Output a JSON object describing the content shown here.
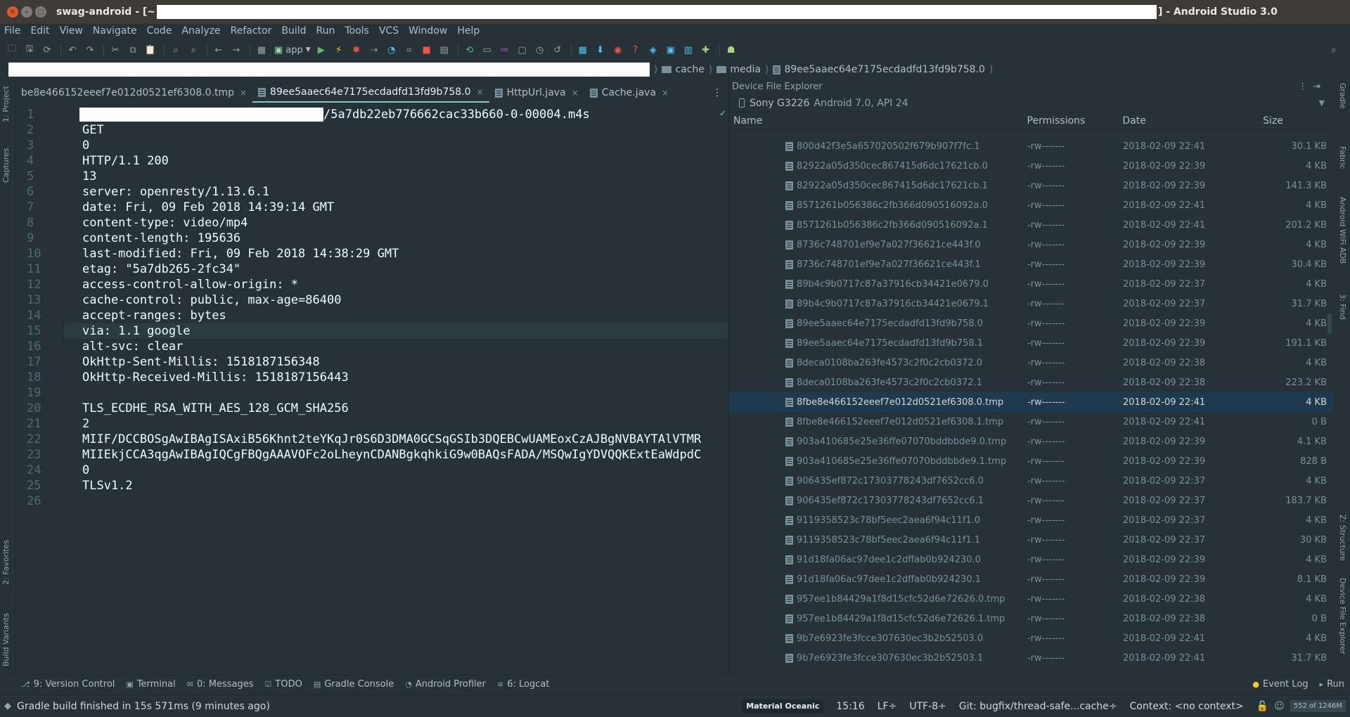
{
  "window": {
    "title_left": "swag-android - [~",
    "title_right": "] - Android Studio 3.0"
  },
  "menu": [
    "File",
    "Edit",
    "View",
    "Navigate",
    "Code",
    "Analyze",
    "Refactor",
    "Build",
    "Run",
    "Tools",
    "VCS",
    "Window",
    "Help"
  ],
  "toolbar": {
    "run_config": "app"
  },
  "breadcrumbs": [
    "cache",
    "media",
    "89ee5aaec64e7175ecdadfd13fd9b758.0"
  ],
  "side_left": {
    "project": "1: Project",
    "captures": "Captures",
    "favorites": "2: Favorites",
    "build_variants": "Build Variants"
  },
  "side_right": {
    "gradle": "Gradle",
    "fabric": "Fabric",
    "wifi_adb": "Android WiFi ADB",
    "find": "3: Find",
    "structure": "Z: Structure",
    "dfe": "Device File Explorer"
  },
  "tabs": [
    {
      "label": "be8e466152eeef7e012d0521ef6308.0.tmp",
      "active": false
    },
    {
      "label": "89ee5aaec64e7175ecdadfd13fd9b758.0",
      "active": true
    },
    {
      "label": "HttpUrl.java",
      "active": false
    },
    {
      "label": "Cache.java",
      "active": false
    }
  ],
  "editor": {
    "first_line_suffix": "/5a7db22eb776662cac33b660-0-00004.m4s",
    "lines": [
      "",
      "GET",
      "0",
      "HTTP/1.1 200",
      "13",
      "server: openresty/1.13.6.1",
      "date: Fri, 09 Feb 2018 14:39:14 GMT",
      "content-type: video/mp4",
      "content-length: 195636",
      "last-modified: Fri, 09 Feb 2018 14:38:29 GMT",
      "etag: \"5a7db265-2fc34\"",
      "access-control-allow-origin: *",
      "cache-control: public, max-age=86400",
      "accept-ranges: bytes",
      "via: 1.1 google",
      "alt-svc: clear",
      "OkHttp-Sent-Millis: 1518187156348",
      "OkHttp-Received-Millis: 1518187156443",
      "",
      "TLS_ECDHE_RSA_WITH_AES_128_GCM_SHA256",
      "2",
      "MIIF/DCCBOSgAwIBAgISAxiB56Khnt2teYKqJr0S6D3DMA0GCSqGSIb3DQEBCwUAMEoxCzAJBgNVBAYTAlVTMR",
      "MIIEkjCCA3qgAwIBAgIQCgFBQgAAAVOFc2oLheynCDANBgkqhkiG9w0BAQsFADA/MSQwIgYDVQQKExtEaWdpdC",
      "0",
      "TLSv1.2",
      ""
    ],
    "highlight_line": 15
  },
  "device_explorer": {
    "title": "Device File Explorer",
    "device": "Sony G3226",
    "api": "Android 7.0, API 24",
    "columns": [
      "Name",
      "Permissions",
      "Date",
      "Size"
    ],
    "files": [
      {
        "name": "800d42f3e5a657020502f679b907f7fc.1",
        "perm": "-rw-------",
        "date": "2018-02-09 22:41",
        "size": "30.1 KB"
      },
      {
        "name": "82922a05d350cec867415d6dc17621cb.0",
        "perm": "-rw-------",
        "date": "2018-02-09 22:39",
        "size": "4 KB"
      },
      {
        "name": "82922a05d350cec867415d6dc17621cb.1",
        "perm": "-rw-------",
        "date": "2018-02-09 22:39",
        "size": "141.3 KB"
      },
      {
        "name": "8571261b056386c2fb366d090516092a.0",
        "perm": "-rw-------",
        "date": "2018-02-09 22:41",
        "size": "4 KB"
      },
      {
        "name": "8571261b056386c2fb366d090516092a.1",
        "perm": "-rw-------",
        "date": "2018-02-09 22:41",
        "size": "201.2 KB"
      },
      {
        "name": "8736c748701ef9e7a027f36621ce443f.0",
        "perm": "-rw-------",
        "date": "2018-02-09 22:39",
        "size": "4 KB"
      },
      {
        "name": "8736c748701ef9e7a027f36621ce443f.1",
        "perm": "-rw-------",
        "date": "2018-02-09 22:39",
        "size": "30.4 KB"
      },
      {
        "name": "89b4c9b0717c87a37916cb34421e0679.0",
        "perm": "-rw-------",
        "date": "2018-02-09 22:37",
        "size": "4 KB"
      },
      {
        "name": "89b4c9b0717c87a37916cb34421e0679.1",
        "perm": "-rw-------",
        "date": "2018-02-09 22:37",
        "size": "31.7 KB"
      },
      {
        "name": "89ee5aaec64e7175ecdadfd13fd9b758.0",
        "perm": "-rw-------",
        "date": "2018-02-09 22:39",
        "size": "4 KB"
      },
      {
        "name": "89ee5aaec64e7175ecdadfd13fd9b758.1",
        "perm": "-rw-------",
        "date": "2018-02-09 22:39",
        "size": "191.1 KB"
      },
      {
        "name": "8deca0108ba263fe4573c2f0c2cb0372.0",
        "perm": "-rw-------",
        "date": "2018-02-09 22:38",
        "size": "4 KB"
      },
      {
        "name": "8deca0108ba263fe4573c2f0c2cb0372.1",
        "perm": "-rw-------",
        "date": "2018-02-09 22:38",
        "size": "223.2 KB"
      },
      {
        "name": "8fbe8e466152eeef7e012d0521ef6308.0.tmp",
        "perm": "-rw-------",
        "date": "2018-02-09 22:41",
        "size": "4 KB",
        "selected": true
      },
      {
        "name": "8fbe8e466152eeef7e012d0521ef6308.1.tmp",
        "perm": "-rw-------",
        "date": "2018-02-09 22:41",
        "size": "0 B"
      },
      {
        "name": "903a410685e25e36ffe07070bddbbde9.0.tmp",
        "perm": "-rw-------",
        "date": "2018-02-09 22:39",
        "size": "4.1 KB"
      },
      {
        "name": "903a410685e25e36ffe07070bddbbde9.1.tmp",
        "perm": "-rw-------",
        "date": "2018-02-09 22:39",
        "size": "828 B"
      },
      {
        "name": "906435ef872c17303778243df7652cc6.0",
        "perm": "-rw-------",
        "date": "2018-02-09 22:37",
        "size": "4 KB"
      },
      {
        "name": "906435ef872c17303778243df7652cc6.1",
        "perm": "-rw-------",
        "date": "2018-02-09 22:37",
        "size": "183.7 KB"
      },
      {
        "name": "9119358523c78bf5eec2aea6f94c11f1.0",
        "perm": "-rw-------",
        "date": "2018-02-09 22:37",
        "size": "4 KB"
      },
      {
        "name": "9119358523c78bf5eec2aea6f94c11f1.1",
        "perm": "-rw-------",
        "date": "2018-02-09 22:37",
        "size": "30 KB"
      },
      {
        "name": "91d18fa06ac97dee1c2dffab0b924230.0",
        "perm": "-rw-------",
        "date": "2018-02-09 22:39",
        "size": "4 KB"
      },
      {
        "name": "91d18fa06ac97dee1c2dffab0b924230.1",
        "perm": "-rw-------",
        "date": "2018-02-09 22:39",
        "size": "8.1 KB"
      },
      {
        "name": "957ee1b84429a1f8d15cfc52d6e72626.0.tmp",
        "perm": "-rw-------",
        "date": "2018-02-09 22:38",
        "size": "4 KB"
      },
      {
        "name": "957ee1b84429a1f8d15cfc52d6e72626.1.tmp",
        "perm": "-rw-------",
        "date": "2018-02-09 22:38",
        "size": "0 B"
      },
      {
        "name": "9b7e6923fe3fcce307630ec3b2b52503.0",
        "perm": "-rw-------",
        "date": "2018-02-09 22:41",
        "size": "4 KB"
      },
      {
        "name": "9b7e6923fe3fcce307630ec3b2b52503.1",
        "perm": "-rw-------",
        "date": "2018-02-09 22:41",
        "size": "31.7 KB"
      }
    ]
  },
  "tool_tabs": [
    {
      "icon": "version-control-icon",
      "glyph": "⎇",
      "label": "9: Version Control"
    },
    {
      "icon": "terminal-icon",
      "glyph": "▣",
      "label": "Terminal"
    },
    {
      "icon": "messages-icon",
      "glyph": "✉",
      "label": "0: Messages"
    },
    {
      "icon": "todo-icon",
      "glyph": "☑",
      "label": "TODO"
    },
    {
      "icon": "gradle-console-icon",
      "glyph": "▤",
      "label": "Gradle Console"
    },
    {
      "icon": "profiler-icon",
      "glyph": "◔",
      "label": "Android Profiler"
    },
    {
      "icon": "logcat-icon",
      "glyph": "≡",
      "label": "6: Logcat"
    }
  ],
  "tool_tabs_right": {
    "event_log": "Event Log",
    "run": "Run"
  },
  "status": {
    "message": "Gradle build finished in 15s 571ms (9 minutes ago)",
    "theme": "Material Oceanic",
    "position": "15:16",
    "line_sep": "LF÷",
    "encoding": "UTF-8÷",
    "git": "Git: bugfix/thread-safe...cache÷",
    "context": "Context: <no context>",
    "memory": "552 of 1246M"
  }
}
